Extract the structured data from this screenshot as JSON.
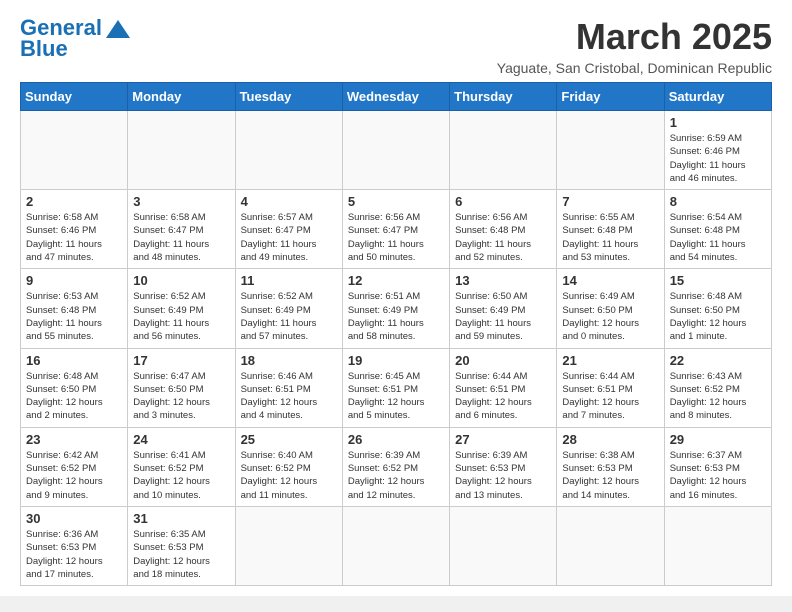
{
  "header": {
    "logo_general": "General",
    "logo_blue": "Blue",
    "title": "March 2025",
    "subtitle": "Yaguate, San Cristobal, Dominican Republic"
  },
  "weekdays": [
    "Sunday",
    "Monday",
    "Tuesday",
    "Wednesday",
    "Thursday",
    "Friday",
    "Saturday"
  ],
  "weeks": [
    [
      {
        "day": "",
        "info": ""
      },
      {
        "day": "",
        "info": ""
      },
      {
        "day": "",
        "info": ""
      },
      {
        "day": "",
        "info": ""
      },
      {
        "day": "",
        "info": ""
      },
      {
        "day": "",
        "info": ""
      },
      {
        "day": "1",
        "info": "Sunrise: 6:59 AM\nSunset: 6:46 PM\nDaylight: 11 hours\nand 46 minutes."
      }
    ],
    [
      {
        "day": "2",
        "info": "Sunrise: 6:58 AM\nSunset: 6:46 PM\nDaylight: 11 hours\nand 47 minutes."
      },
      {
        "day": "3",
        "info": "Sunrise: 6:58 AM\nSunset: 6:47 PM\nDaylight: 11 hours\nand 48 minutes."
      },
      {
        "day": "4",
        "info": "Sunrise: 6:57 AM\nSunset: 6:47 PM\nDaylight: 11 hours\nand 49 minutes."
      },
      {
        "day": "5",
        "info": "Sunrise: 6:56 AM\nSunset: 6:47 PM\nDaylight: 11 hours\nand 50 minutes."
      },
      {
        "day": "6",
        "info": "Sunrise: 6:56 AM\nSunset: 6:48 PM\nDaylight: 11 hours\nand 52 minutes."
      },
      {
        "day": "7",
        "info": "Sunrise: 6:55 AM\nSunset: 6:48 PM\nDaylight: 11 hours\nand 53 minutes."
      },
      {
        "day": "8",
        "info": "Sunrise: 6:54 AM\nSunset: 6:48 PM\nDaylight: 11 hours\nand 54 minutes."
      }
    ],
    [
      {
        "day": "9",
        "info": "Sunrise: 6:53 AM\nSunset: 6:48 PM\nDaylight: 11 hours\nand 55 minutes."
      },
      {
        "day": "10",
        "info": "Sunrise: 6:52 AM\nSunset: 6:49 PM\nDaylight: 11 hours\nand 56 minutes."
      },
      {
        "day": "11",
        "info": "Sunrise: 6:52 AM\nSunset: 6:49 PM\nDaylight: 11 hours\nand 57 minutes."
      },
      {
        "day": "12",
        "info": "Sunrise: 6:51 AM\nSunset: 6:49 PM\nDaylight: 11 hours\nand 58 minutes."
      },
      {
        "day": "13",
        "info": "Sunrise: 6:50 AM\nSunset: 6:49 PM\nDaylight: 11 hours\nand 59 minutes."
      },
      {
        "day": "14",
        "info": "Sunrise: 6:49 AM\nSunset: 6:50 PM\nDaylight: 12 hours\nand 0 minutes."
      },
      {
        "day": "15",
        "info": "Sunrise: 6:48 AM\nSunset: 6:50 PM\nDaylight: 12 hours\nand 1 minute."
      }
    ],
    [
      {
        "day": "16",
        "info": "Sunrise: 6:48 AM\nSunset: 6:50 PM\nDaylight: 12 hours\nand 2 minutes."
      },
      {
        "day": "17",
        "info": "Sunrise: 6:47 AM\nSunset: 6:50 PM\nDaylight: 12 hours\nand 3 minutes."
      },
      {
        "day": "18",
        "info": "Sunrise: 6:46 AM\nSunset: 6:51 PM\nDaylight: 12 hours\nand 4 minutes."
      },
      {
        "day": "19",
        "info": "Sunrise: 6:45 AM\nSunset: 6:51 PM\nDaylight: 12 hours\nand 5 minutes."
      },
      {
        "day": "20",
        "info": "Sunrise: 6:44 AM\nSunset: 6:51 PM\nDaylight: 12 hours\nand 6 minutes."
      },
      {
        "day": "21",
        "info": "Sunrise: 6:44 AM\nSunset: 6:51 PM\nDaylight: 12 hours\nand 7 minutes."
      },
      {
        "day": "22",
        "info": "Sunrise: 6:43 AM\nSunset: 6:52 PM\nDaylight: 12 hours\nand 8 minutes."
      }
    ],
    [
      {
        "day": "23",
        "info": "Sunrise: 6:42 AM\nSunset: 6:52 PM\nDaylight: 12 hours\nand 9 minutes."
      },
      {
        "day": "24",
        "info": "Sunrise: 6:41 AM\nSunset: 6:52 PM\nDaylight: 12 hours\nand 10 minutes."
      },
      {
        "day": "25",
        "info": "Sunrise: 6:40 AM\nSunset: 6:52 PM\nDaylight: 12 hours\nand 11 minutes."
      },
      {
        "day": "26",
        "info": "Sunrise: 6:39 AM\nSunset: 6:52 PM\nDaylight: 12 hours\nand 12 minutes."
      },
      {
        "day": "27",
        "info": "Sunrise: 6:39 AM\nSunset: 6:53 PM\nDaylight: 12 hours\nand 13 minutes."
      },
      {
        "day": "28",
        "info": "Sunrise: 6:38 AM\nSunset: 6:53 PM\nDaylight: 12 hours\nand 14 minutes."
      },
      {
        "day": "29",
        "info": "Sunrise: 6:37 AM\nSunset: 6:53 PM\nDaylight: 12 hours\nand 16 minutes."
      }
    ],
    [
      {
        "day": "30",
        "info": "Sunrise: 6:36 AM\nSunset: 6:53 PM\nDaylight: 12 hours\nand 17 minutes."
      },
      {
        "day": "31",
        "info": "Sunrise: 6:35 AM\nSunset: 6:53 PM\nDaylight: 12 hours\nand 18 minutes."
      },
      {
        "day": "",
        "info": ""
      },
      {
        "day": "",
        "info": ""
      },
      {
        "day": "",
        "info": ""
      },
      {
        "day": "",
        "info": ""
      },
      {
        "day": "",
        "info": ""
      }
    ]
  ]
}
